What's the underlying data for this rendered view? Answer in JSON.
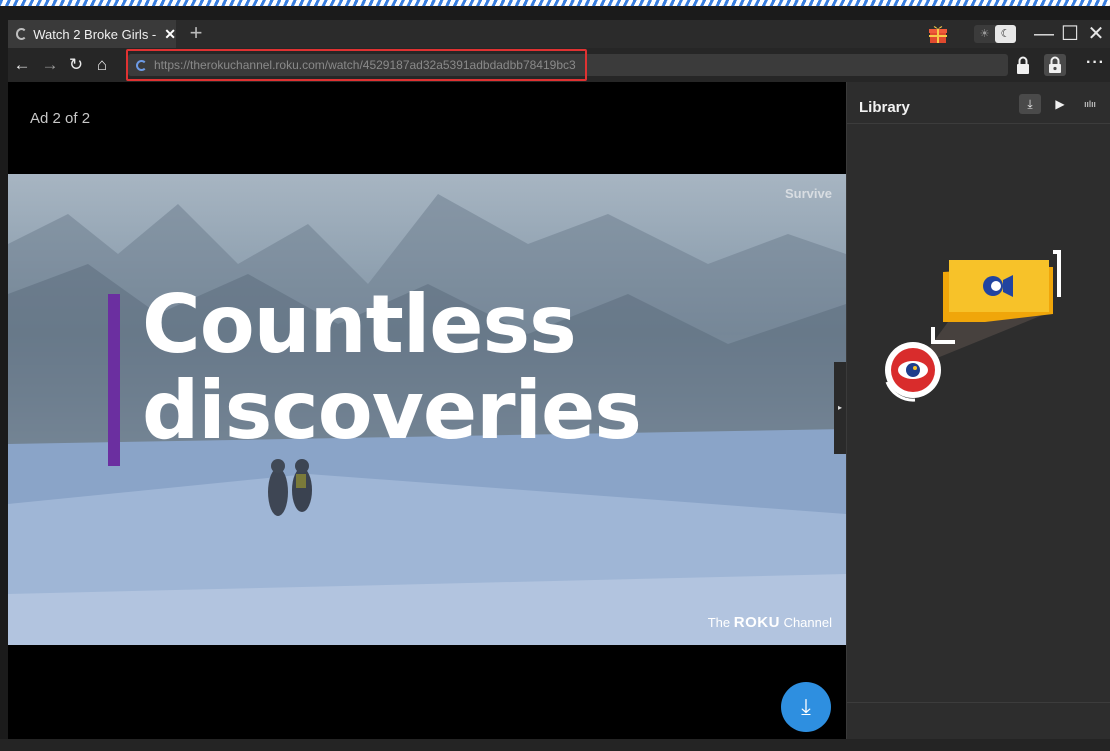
{
  "tab": {
    "title": "Watch 2 Broke Girls -",
    "close": "✕",
    "new": "+"
  },
  "window": {
    "minimize": "—",
    "maximize": "☐",
    "close": "✕",
    "theme_light": "☀",
    "theme_dark": "☾"
  },
  "nav": {
    "back": "←",
    "forward": "→",
    "reload": "↻",
    "home": "⌂",
    "more": "···"
  },
  "address": {
    "url": "https://therokuchannel.roku.com/watch/4529187ad32a5391adbdadbb78419bc3"
  },
  "player": {
    "ad_label": "Ad 2 of 2",
    "badge": "Survive",
    "headline_line1": "Countless",
    "headline_line2": "discoveries",
    "brand_prefix": "The",
    "brand_name": "ROKU",
    "brand_suffix": "Channel",
    "collapse": "▸",
    "download": "⤓"
  },
  "library": {
    "title": "Library",
    "tabs": [
      {
        "icon": "download-icon",
        "glyph": "⤓"
      },
      {
        "icon": "video-icon",
        "glyph": "▶"
      },
      {
        "icon": "audio-icon",
        "glyph": "ıılıı"
      }
    ]
  },
  "colors": {
    "accent": "#2e8fe0",
    "highlight": "#e03232",
    "promo_purple": "#6b2fa0"
  }
}
